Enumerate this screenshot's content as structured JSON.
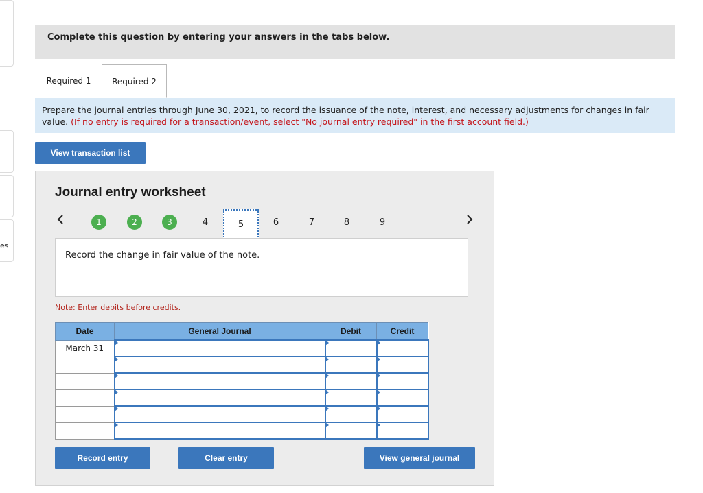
{
  "banner": {
    "text": "Complete this question by entering your answers in the tabs below."
  },
  "sidebar": {
    "fragment_text": "es"
  },
  "tabs": [
    {
      "label": "Required 1"
    },
    {
      "label": "Required 2"
    }
  ],
  "instructions": {
    "main": "Prepare the journal entries through June 30, 2021, to record the issuance of the note, interest, and necessary adjustments for changes in fair value.",
    "hint": "(If no entry is required for a transaction/event, select \"No journal entry required\" in the first account field.)"
  },
  "buttons": {
    "view_transaction_list": "View transaction list",
    "record_entry": "Record entry",
    "clear_entry": "Clear entry",
    "view_general_journal": "View general journal"
  },
  "worksheet": {
    "title": "Journal entry worksheet",
    "prev_icon": "chevron-left-icon",
    "next_icon": "chevron-right-icon",
    "steps": [
      "1",
      "2",
      "3",
      "4",
      "5",
      "6",
      "7",
      "8",
      "9"
    ],
    "completed_steps": [
      "1",
      "2",
      "3"
    ],
    "current_step": "5",
    "description": "Record the change in fair value of the note.",
    "note": "Note: Enter debits before credits.",
    "table": {
      "headers": {
        "date": "Date",
        "account": "General Journal",
        "debit": "Debit",
        "credit": "Credit"
      },
      "rows": [
        {
          "date": "March 31",
          "account": "",
          "debit": "",
          "credit": ""
        },
        {
          "date": "",
          "account": "",
          "debit": "",
          "credit": ""
        },
        {
          "date": "",
          "account": "",
          "debit": "",
          "credit": ""
        },
        {
          "date": "",
          "account": "",
          "debit": "",
          "credit": ""
        },
        {
          "date": "",
          "account": "",
          "debit": "",
          "credit": ""
        },
        {
          "date": "",
          "account": "",
          "debit": "",
          "credit": ""
        }
      ]
    }
  },
  "colors": {
    "accent_blue": "#3b77bc",
    "header_blue": "#7ab0e3",
    "instruction_bg": "#daeaf7",
    "step_done_green": "#4caf50",
    "hint_red": "#c4161c"
  }
}
